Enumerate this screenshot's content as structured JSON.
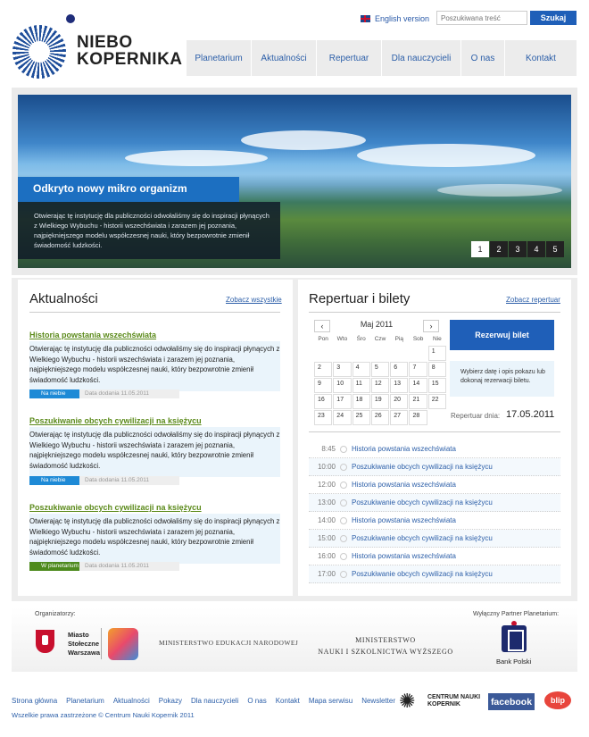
{
  "brand": {
    "name_line1": "NIEBO",
    "name_line2": "KOPERNIKA"
  },
  "header": {
    "language_link": "English version",
    "search_placeholder": "Poszukiwana treść",
    "search_button": "Szukaj"
  },
  "nav": [
    "Planetarium",
    "Aktualności",
    "Repertuar",
    "Dla nauczycieli",
    "O nas",
    "Kontakt"
  ],
  "hero": {
    "title": "Odkryto nowy mikro organizm",
    "text": "Otwierając tę instytucję dla publiczności odwołaliśmy się do inspiracji płynących z Wielkiego Wybuchu - historii wszechświata i zarazem jej poznania, najpiękniejszego modelu współczesnej nauki, który bezpowrotnie zmienił świadomość ludzkości.",
    "pages": [
      "1",
      "2",
      "3",
      "4",
      "5"
    ],
    "active_page": "1"
  },
  "news": {
    "title": "Aktualności",
    "see_all": "Zobacz wszystkie",
    "items": [
      {
        "heading": "Historia powstania wszechświata",
        "body": "Otwierając tę instytucję dla publiczności odwołaliśmy się do inspiracji płynących z Wielkiego Wybuchu - historii wszechświata i zarazem jej poznania, najpiękniejszego modelu współczesnej nauki, który bezpowrotnie zmienił świadomość ludzkości.",
        "tag": "Na niebie",
        "tag_color": "#1e8ad6",
        "date": "Data dodania 11.05.2011"
      },
      {
        "heading": "Poszukiwanie obcych cywilizacji na księżycu",
        "body": "Otwierając tę instytucję dla publiczności odwołaliśmy się do inspiracji płynących z Wielkiego Wybuchu - historii wszechświata i zarazem jej poznania, najpiękniejszego modelu współczesnej nauki, który bezpowrotnie zmienił świadomość ludzkości.",
        "tag": "Na niebie",
        "tag_color": "#1e8ad6",
        "date": "Data dodania 11.05.2011"
      },
      {
        "heading": "Poszukiwanie obcych cywilizacji na księżycu",
        "body": "Otwierając tę instytucję dla publiczności odwołaliśmy się do inspiracji płynących z Wielkiego Wybuchu - historii wszechświata i zarazem jej poznania, najpiękniejszego modelu współczesnej nauki, który bezpowrotnie zmienił świadomość ludzkości.",
        "tag": "W planetarium",
        "tag_color": "#4d8a1d",
        "date": "Data dodania 11.05.2011"
      }
    ]
  },
  "repertoire": {
    "title": "Repertuar i bilety",
    "see_link": "Zobacz repertuar",
    "calendar": {
      "month": "Maj 2011",
      "prev": "‹",
      "next": "›",
      "weekdays": [
        "Pon",
        "Wto",
        "Śro",
        "Czw",
        "Pią",
        "Sob",
        "Nie"
      ],
      "cells": [
        "",
        "",
        "",
        "",
        "",
        "",
        "1",
        "2",
        "3",
        "4",
        "5",
        "6",
        "7",
        "8",
        "9",
        "10",
        "11",
        "12",
        "13",
        "14",
        "15",
        "16",
        "17",
        "18",
        "19",
        "20",
        "21",
        "22",
        "23",
        "24",
        "25",
        "26",
        "27",
        "28",
        "",
        "",
        "",
        "",
        "",
        ""
      ]
    },
    "book_button": "Rezerwuj bilet",
    "hint": "Wybierz datę i opis pokazu lub dokonaj rezerwacji biletu.",
    "date_label": "Repertuar dnia:",
    "date_value": "17.05.2011",
    "schedule": [
      {
        "time": "8:45",
        "title": "Historia powstania wszechświata"
      },
      {
        "time": "10:00",
        "title": "Poszukiwanie obcych cywilizacji na księżycu"
      },
      {
        "time": "12:00",
        "title": "Historia powstania wszechświata"
      },
      {
        "time": "13:00",
        "title": "Poszukiwanie obcych cywilizacji na księżycu"
      },
      {
        "time": "14:00",
        "title": "Historia powstania wszechświata"
      },
      {
        "time": "15:00",
        "title": "Poszukiwanie obcych cywilizacji na księżycu"
      },
      {
        "time": "16:00",
        "title": "Historia powstania wszechświata"
      },
      {
        "time": "17:00",
        "title": "Poszukiwanie obcych cywilizacji na księżycu"
      }
    ]
  },
  "sponsors": {
    "organizers_label": "Organizatorzy:",
    "partner_label": "Wyłączny Partner Planetarium:",
    "city_line1": "Miasto",
    "city_line2": "Stołeczne",
    "city_line3": "Warszawa",
    "ministry_edu": "MINISTERSTWO EDUKACJI NARODOWEJ",
    "ministry_sci_line1": "MINISTERSTWO",
    "ministry_sci_line2": "NAUKI I SZKOLNICTWA WYŻSZEGO",
    "partner_name": "Bank Polski"
  },
  "footer": {
    "links": [
      "Strona główna",
      "Planetarium",
      "Aktualności",
      "Pokazy",
      "Dla nauczycieli",
      "O nas",
      "Kontakt",
      "Mapa serwisu",
      "Newsletter"
    ],
    "copyright": "Wszelkie prawa zastrzeżone © Centrum Nauki Kopernik 2011",
    "cnk_line1": "CENTRUM NAUKI",
    "cnk_line2": "KOPERNIK",
    "facebook": "facebook",
    "blip": "blip"
  }
}
